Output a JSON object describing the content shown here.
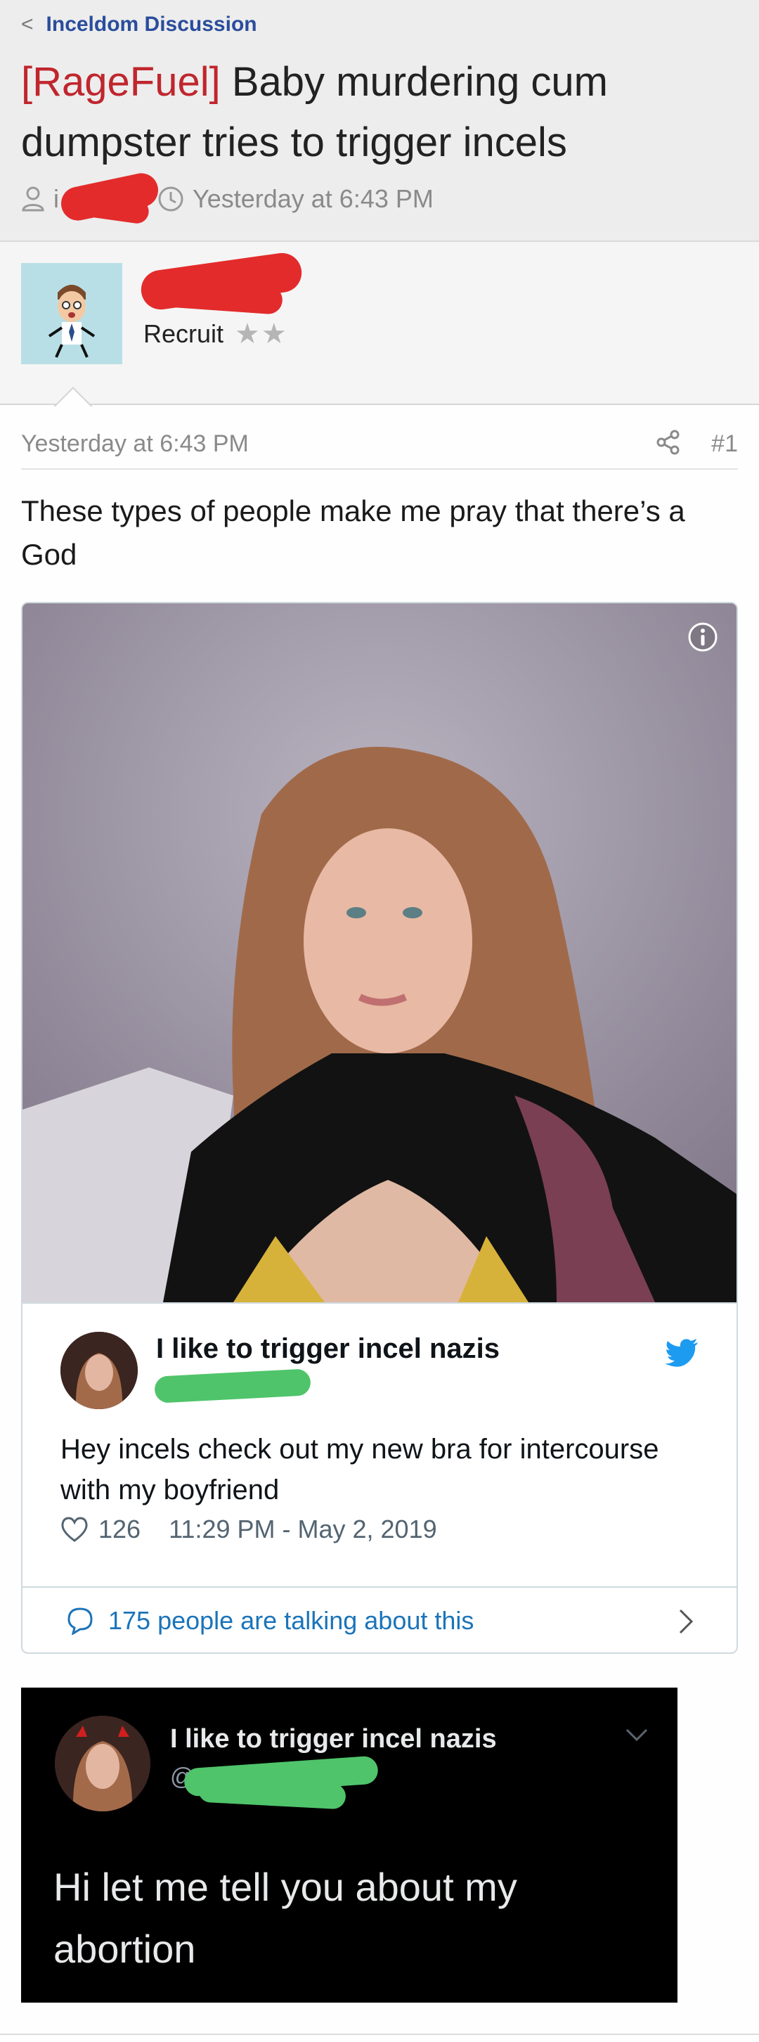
{
  "breadcrumb": {
    "label": "Inceldom Discussion"
  },
  "thread": {
    "prefix": "[RageFuel]",
    "title": "Baby murdering cum dumpster tries to trigger incels",
    "author_visible": "i",
    "time": "Yesterday at 6:43 PM"
  },
  "author": {
    "rank": "Recruit",
    "stars": "★★"
  },
  "post": {
    "time": "Yesterday at 6:43 PM",
    "number": "#1",
    "text": "These types of people make me pray that there’s a God"
  },
  "tweet": {
    "display_name": "I like to trigger incel nazis",
    "text": "Hey incels check out my new bra for intercourse with my boyfriend",
    "likes": "126",
    "timestamp": "11:29 PM - May 2, 2019",
    "talking": "175 people are talking about this"
  },
  "dark_tweet": {
    "display_name": "I like to trigger incel nazis",
    "handle_prefix": "@",
    "text": "Hi let me tell you about my abortion"
  },
  "colors": {
    "link_blue": "#2a4d9c",
    "prefix_red": "#c0262d",
    "twitter_blue": "#1d9bf0",
    "redaction_red": "#e32b2b",
    "redaction_green": "#4fc46a"
  }
}
